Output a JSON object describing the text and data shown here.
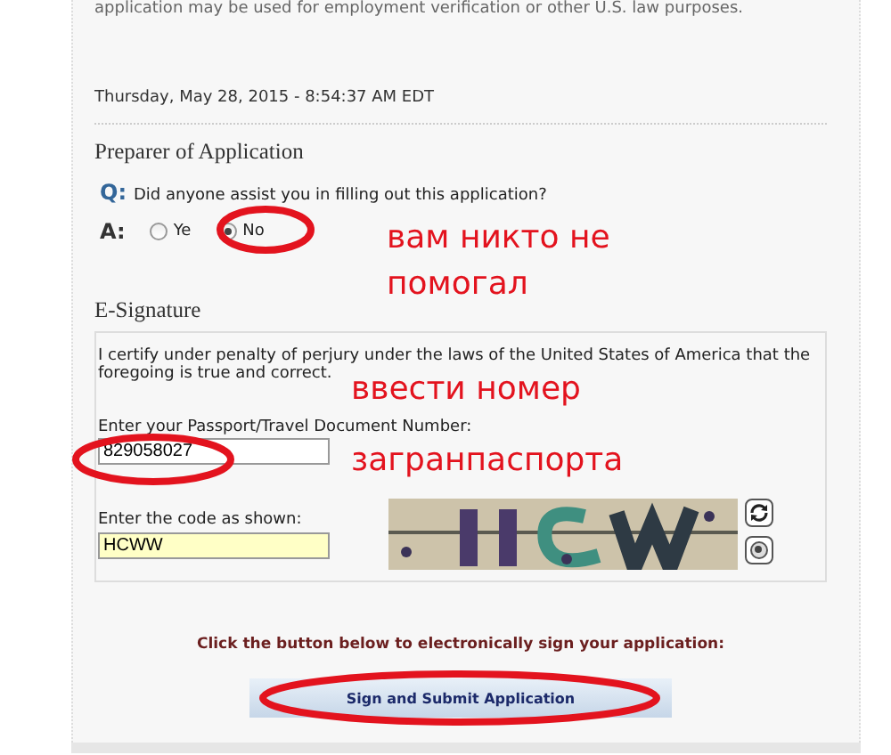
{
  "intro_text": "application may be used for employment verification or other U.S. law purposes.",
  "timestamp": "Thursday, May 28, 2015 - 8:54:37 AM EDT",
  "preparer": {
    "heading": "Preparer of Application",
    "question_marker": "Q:",
    "question": "Did anyone assist you in filling out this application?",
    "answer_marker": "A:",
    "options": [
      {
        "label": "Ye",
        "selected": false
      },
      {
        "label": "No",
        "selected": true
      }
    ]
  },
  "signature": {
    "heading": "E-Signature",
    "statement": "I certify under penalty of perjury under the laws of the United States of America that the foregoing is true and correct.",
    "passport_label": "Enter your Passport/Travel Document Number:",
    "passport_value": "829058027",
    "code_label": "Enter the code as shown:",
    "code_value": "HCWW"
  },
  "sign_prompt": "Click the button below to electronically sign your application:",
  "submit_button": "Sign and Submit Application",
  "notes": [
    {
      "text": "вам никто не"
    },
    {
      "text": "помогал"
    },
    {
      "text": "ввести номер"
    },
    {
      "text": "загранпаспорта"
    }
  ]
}
